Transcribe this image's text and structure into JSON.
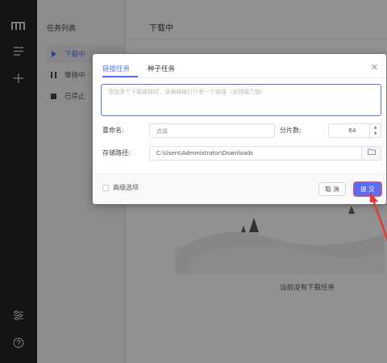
{
  "sidebar": {
    "icons": [
      "logo-icon",
      "menu-icon",
      "add-icon",
      "settings-icon",
      "help-icon"
    ]
  },
  "tasklist": {
    "title": "任务列表",
    "items": [
      {
        "label": "下载中",
        "icon": "play-icon",
        "active": true
      },
      {
        "label": "等待中",
        "icon": "pause-icon",
        "active": false
      },
      {
        "label": "已停止",
        "icon": "stop-icon",
        "active": false
      }
    ]
  },
  "main": {
    "title": "下载中",
    "empty_text": "当前没有下载任务"
  },
  "dialog": {
    "tabs": [
      "链接任务",
      "种子任务"
    ],
    "active_tab": 0,
    "url_placeholder": "添加多个下载链接时，请确保每行只有一个链接（支持磁力链）",
    "rename_label": "重命名:",
    "rename_placeholder": "选填",
    "segments_label": "分片数:",
    "segments_value": "64",
    "path_label": "存储路径:",
    "path_value": "C:\\Users\\Administrator\\Downloads",
    "advanced_label": "高级选项",
    "cancel_label": "取 消",
    "submit_label": "提 交"
  },
  "colors": {
    "accent": "#5b6df2",
    "sidebar": "#222325",
    "highlight": "#ff4d4f"
  }
}
